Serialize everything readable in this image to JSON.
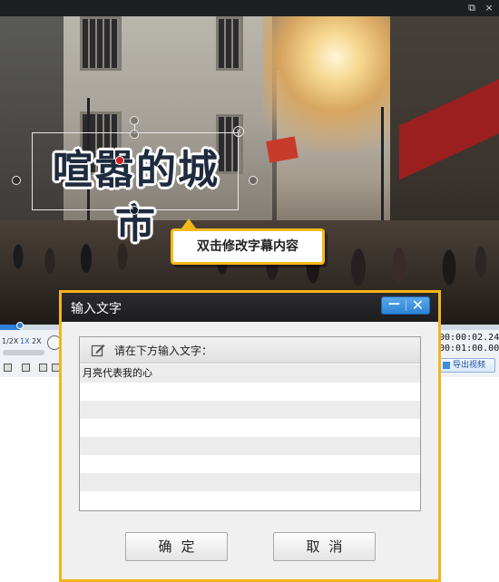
{
  "window": {
    "restore_glyph": "⧉",
    "close_glyph": "×"
  },
  "video": {
    "caption_text": "喧嚣的城市",
    "close_glyph": "×",
    "hint_text": "双击修改字幕内容",
    "progress_fraction": 0.04
  },
  "player": {
    "speeds": [
      "1/2X",
      "1X",
      "2X"
    ],
    "active_speed": "1X",
    "time_current": "00:00:02.240",
    "time_total": "00:01:00.000",
    "export_label": "导出视频"
  },
  "dialog": {
    "title": "输入文字",
    "minimize_glyph": "—",
    "close_glyph": "✕",
    "instruction": "请在下方输入文字：",
    "lines": [
      "月亮代表我的心",
      "",
      "",
      "",
      "",
      "",
      "",
      ""
    ],
    "ok_label": "确定",
    "cancel_label": "取消"
  },
  "colors": {
    "accent_yellow": "#f3b51b",
    "title_bar": "#1d1d1f",
    "control_blue": "#2c83d4",
    "progress_blue": "#2f7ed8"
  },
  "icons": {
    "window_restore": "restore-icon",
    "window_close": "close-icon",
    "caption_close": "close-icon",
    "edit": "edit-icon",
    "export": "export-icon",
    "play": "play-icon"
  }
}
